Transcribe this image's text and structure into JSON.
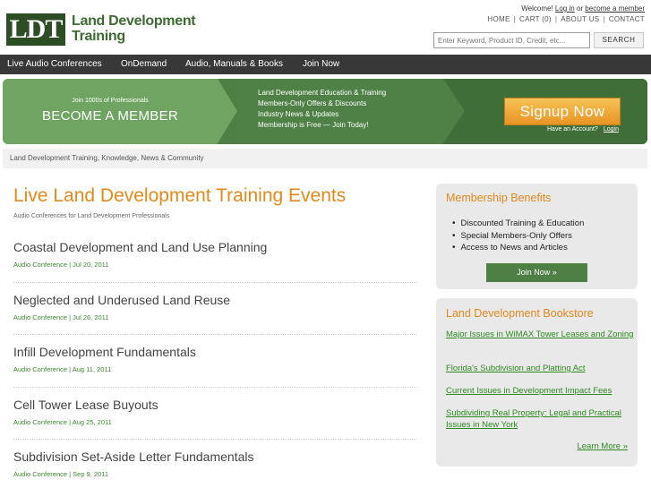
{
  "header": {
    "logo_mark": "LDT",
    "logo_line1": "Land Development",
    "logo_line2": "Training",
    "welcome_prefix": "Welcome!",
    "login_link": "Log in",
    "or_text": "or",
    "become_link": "become a member",
    "toplinks": [
      "HOME",
      "CART (0)",
      "ABOUT US",
      "CONTACT"
    ],
    "search_placeholder": "Enter Keyword, Product ID, Credit, etc...",
    "search_button": "SEARCH"
  },
  "nav": {
    "items": [
      "Live Audio Conferences",
      "OnDemand",
      "Audio, Manuals & Books",
      "Join Now"
    ]
  },
  "banner": {
    "small_text": "Join 1000s of Professionals",
    "big_text": "BECOME A MEMBER",
    "benefits": [
      "Land Development Education & Training",
      "Members-Only Offers & Discounts",
      "Industry News & Updates",
      "Membership is Free — Join Today!"
    ],
    "signup_label": "Signup Now",
    "have_account": "Have an Account?",
    "login_label": "Login"
  },
  "tagline": "Land Development Training, Knowledge, News & Community",
  "main": {
    "title": "Live Land Development Training Events",
    "subtitle": "Audio Conferences for Land Development Professionals",
    "events": [
      {
        "title": "Coastal Development and Land Use Planning",
        "meta": "Audio Conference | Jul 20, 2011"
      },
      {
        "title": "Neglected and Underused Land Reuse",
        "meta": "Audio Conference | Jul 26, 2011"
      },
      {
        "title": "Infill Development Fundamentals",
        "meta": "Audio Conference | Aug 11, 2011"
      },
      {
        "title": "Cell Tower Lease Buyouts",
        "meta": "Audio Conference | Aug 25, 2011"
      },
      {
        "title": "Subdivision Set-Aside Letter Fundamentals",
        "meta": "Audio Conference | Sep 9, 2011"
      }
    ]
  },
  "sidebar": {
    "membership": {
      "title": "Membership Benefits",
      "items": [
        "Discounted Training & Education",
        "Special Members-Only Offers",
        "Access to News and Articles"
      ],
      "button": "Join Now »"
    },
    "bookstore": {
      "title": "Land Development Bookstore",
      "links": [
        "Major Issues in WiMAX Tower Leases and Zoning",
        "Florida's Subdivision and Platting Act",
        "Current Issues in Development Impact Fees",
        "Subdividing Real Property: Legal and Practical Issues in New York"
      ],
      "learn_more": "Learn More »"
    }
  }
}
